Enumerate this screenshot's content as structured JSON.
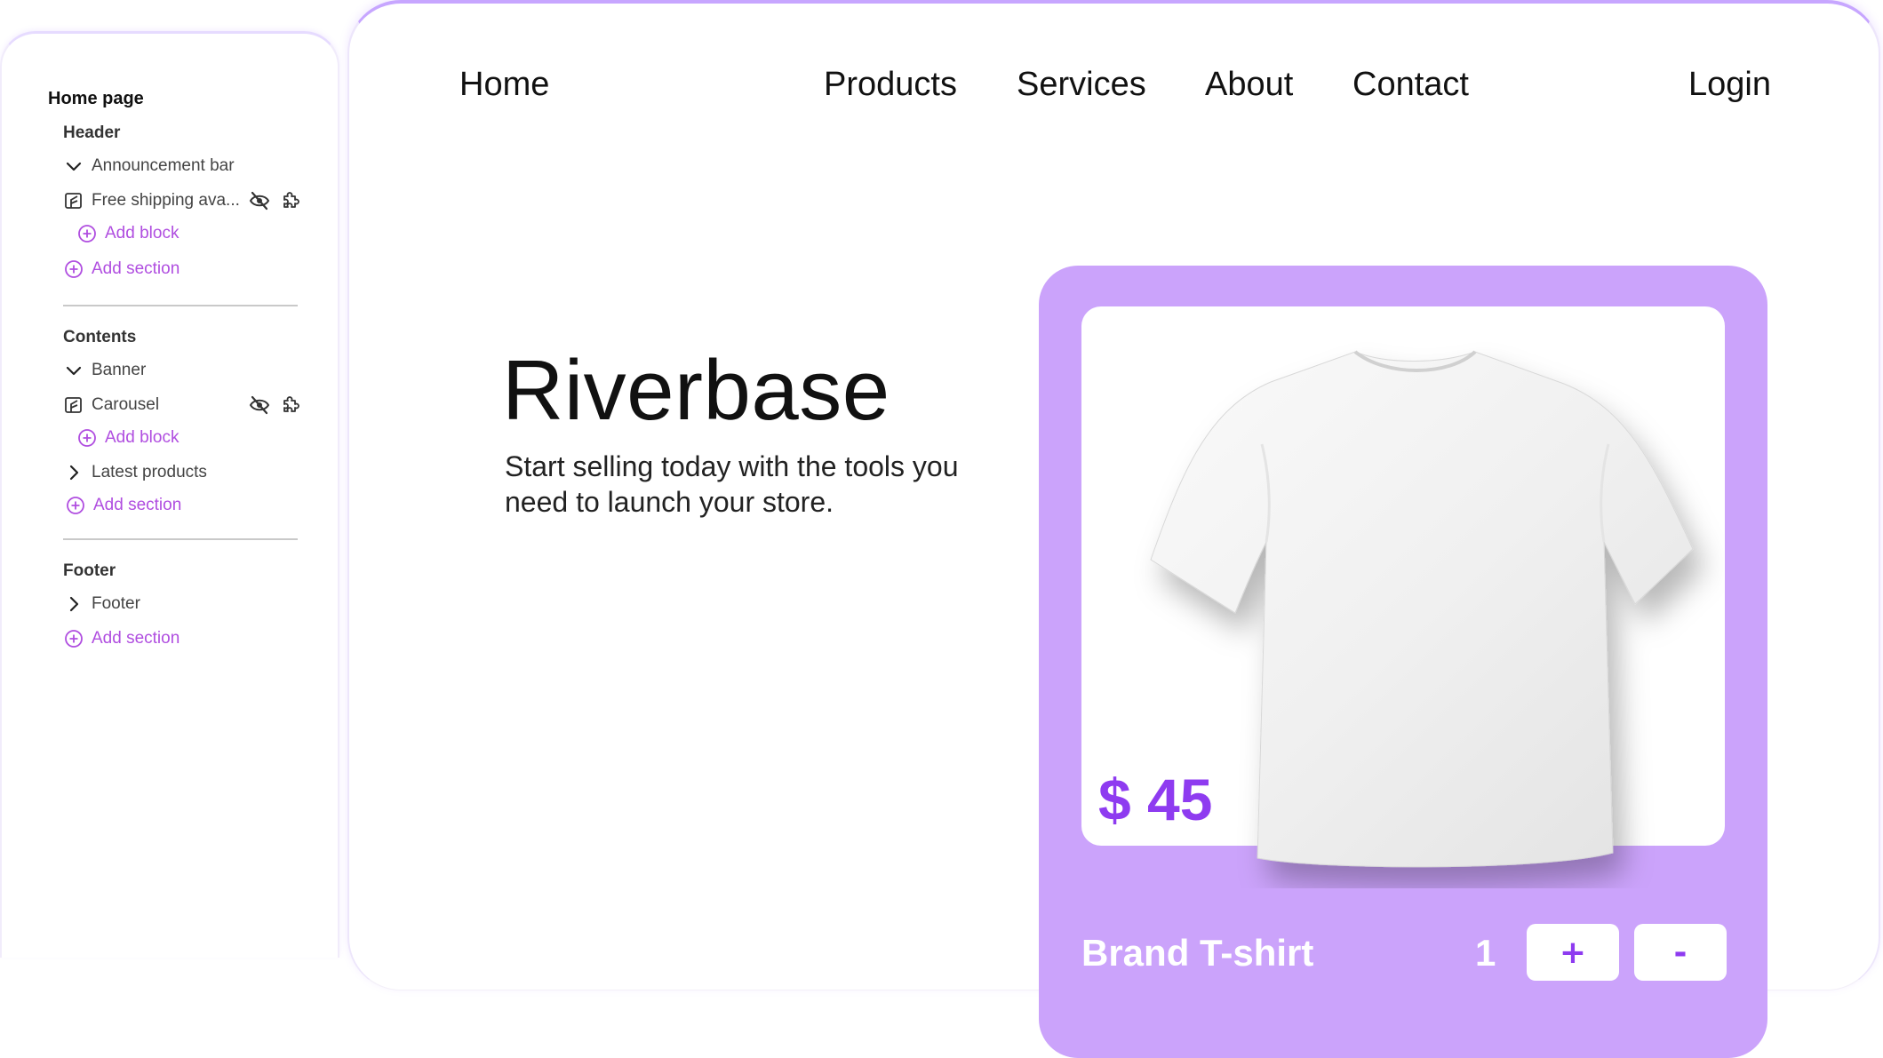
{
  "sidebar": {
    "title": "Home page",
    "header_group": "Header",
    "announcement_bar": "Announcement bar",
    "free_shipping": "Free shipping ava...",
    "add_block_1": "Add block",
    "add_section_1": "Add section",
    "contents_group": "Contents",
    "banner": "Banner",
    "carousel": "Carousel",
    "add_block_2": "Add block",
    "latest_products": "Latest products",
    "add_section_2": "Add section",
    "footer_group": "Footer",
    "footer": "Footer",
    "add_section_3": "Add section",
    "accent": "#b04ee0"
  },
  "nav": {
    "home": "Home",
    "products": "Products",
    "services": "Services",
    "about": "About",
    "contact": "Contact",
    "login": "Login"
  },
  "hero": {
    "title": "Riverbase",
    "subtitle": "Start selling today with the tools you need to launch your store."
  },
  "product": {
    "price": "$ 45",
    "name": "Brand T-shirt",
    "quantity": "1",
    "plus_label": "+",
    "minus_label": "-",
    "card_color": "#cba3fb",
    "price_color": "#8e3bf0"
  }
}
